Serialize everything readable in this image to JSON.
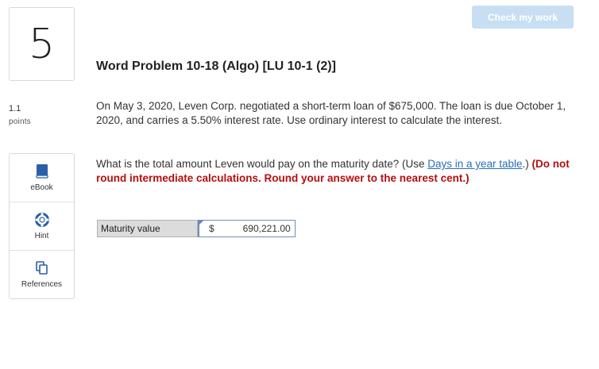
{
  "question": {
    "number": "5",
    "points_value": "1.1",
    "points_label": "points"
  },
  "header": {
    "check_button_label": "Check my work",
    "title": "Word Problem 10-18 (Algo) [LU 10-1 (2)]"
  },
  "tools": [
    {
      "label": "eBook",
      "icon": "book-icon"
    },
    {
      "label": "Hint",
      "icon": "lifebuoy-icon"
    },
    {
      "label": "References",
      "icon": "copy-pages-icon"
    }
  ],
  "problem": {
    "text": "On May 3, 2020, Leven Corp. negotiated a short-term loan of $675,000. The loan is due October 1, 2020, and carries a 5.50% interest rate. Use ordinary interest to calculate the interest."
  },
  "prompt": {
    "text_before": "What is the total amount Leven would pay on the maturity date? (Use ",
    "link_text": "Days in a year table",
    "text_after": ".) ",
    "instruction": "(Do not round intermediate calculations. Round your answer to the nearest cent.)"
  },
  "answer": {
    "label": "Maturity value",
    "currency": "$",
    "value": "690,221.00"
  },
  "colors": {
    "link": "#2a6ebb",
    "instruction": "#b50e0e",
    "check_button": "#c8dff3",
    "tool_icon": "#2b5fa8"
  }
}
